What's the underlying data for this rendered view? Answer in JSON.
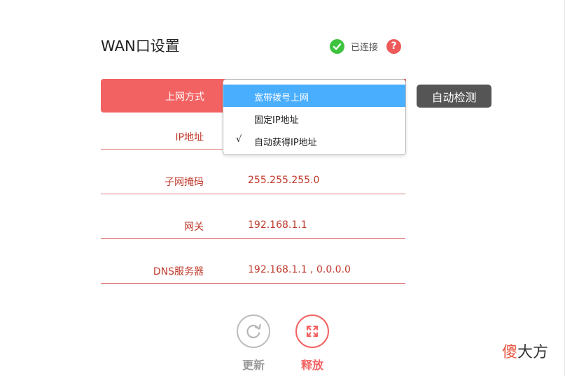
{
  "title": "WAN口设置",
  "status": {
    "text": "已连接",
    "icon": "check-circle-icon",
    "help_icon": "?"
  },
  "colors": {
    "accent": "#f36262",
    "selected": "#4aaeff",
    "ok": "#3ec33e",
    "button_dark": "#555555"
  },
  "connection_type": {
    "label": "上网方式",
    "selected": "宽带拨号上网"
  },
  "dropdown": {
    "options": [
      {
        "label": "宽带拨号上网",
        "highlighted": true,
        "check": ""
      },
      {
        "label": "固定IP地址",
        "highlighted": false,
        "check": ""
      },
      {
        "label": "自动获得IP地址",
        "highlighted": false,
        "check": "√"
      }
    ]
  },
  "fields": [
    {
      "label": "IP地址",
      "value": ""
    },
    {
      "label": "子网掩码",
      "value": "255.255.255.0"
    },
    {
      "label": "网关",
      "value": "192.168.1.1"
    },
    {
      "label": "DNS服务器",
      "value": "192.168.1.1 , 0.0.0.0"
    }
  ],
  "actions": {
    "detect_label": "自动检测",
    "refresh_label": "更新",
    "release_label": "释放"
  },
  "watermark": {
    "first": "傻",
    "rest": "大方"
  }
}
